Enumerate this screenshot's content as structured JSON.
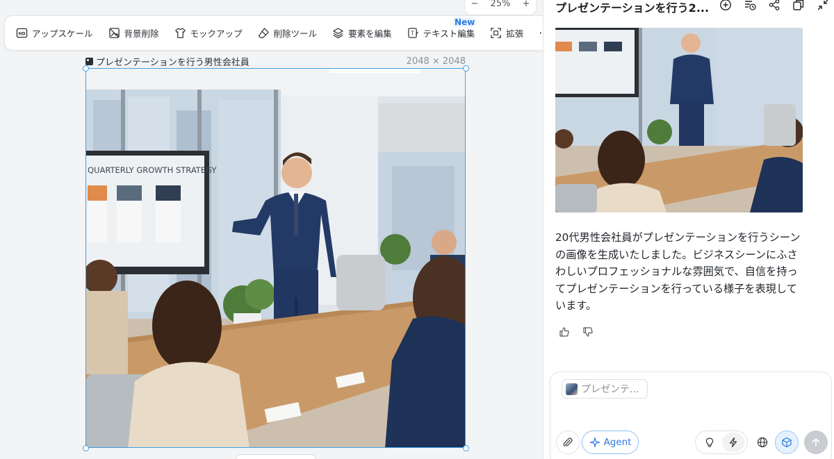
{
  "zoom": {
    "minus": "−",
    "level": "25%",
    "plus": "+"
  },
  "toolbar": {
    "tools": [
      {
        "id": "upscale",
        "label": "アップスケール",
        "icon": "hd-icon"
      },
      {
        "id": "remove-bg",
        "label": "背景削除",
        "icon": "image-remove-icon"
      },
      {
        "id": "mockup",
        "label": "モックアップ",
        "icon": "shirt-icon"
      },
      {
        "id": "eraser",
        "label": "削除ツール",
        "icon": "eraser-icon"
      },
      {
        "id": "edit-elements",
        "label": "要素を編集",
        "icon": "layers-icon"
      },
      {
        "id": "edit-text",
        "label": "テキスト編集",
        "icon": "text-edit-icon",
        "badge": "New"
      },
      {
        "id": "expand",
        "label": "拡張",
        "icon": "expand-icon"
      }
    ],
    "more": "···"
  },
  "canvas": {
    "image_name": "プレゼンテーションを行う男性会社員",
    "image_size": "2048 × 2048",
    "slide_title": "QUARTERLY GROWTH STRATEGY"
  },
  "chat": {
    "title": "プレゼンテーションを行う2...",
    "header_icons": [
      "new-chat-icon",
      "history-icon",
      "share-icon",
      "copy-icon",
      "collapse-icon"
    ],
    "message": "20代男性会社員がプレゼンテーションを行うシーンの画像を生成いたしました。ビジネスシーンにふさわしいプロフェッショナルな雰囲気で、自信を持ってプレゼンテーションを行っている様子を表現しています。",
    "composer": {
      "ref_chip": "プレゼンテ...",
      "agent_label": "Agent"
    }
  },
  "colors": {
    "accent": "#3aa0e8",
    "agent": "#2c7be5",
    "badge": "#2a7de1"
  }
}
